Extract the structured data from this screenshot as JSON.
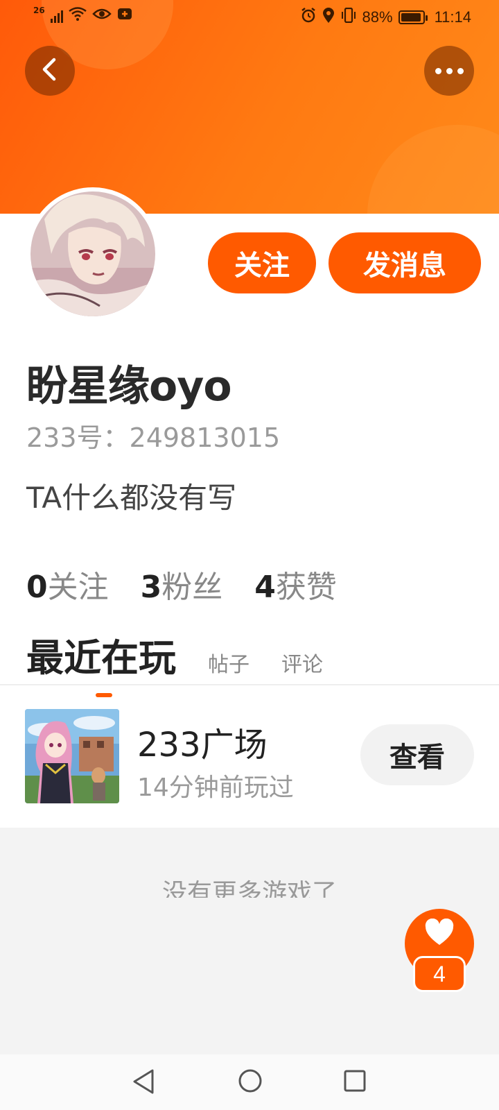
{
  "status_bar": {
    "network": "26",
    "battery_percent": "88%",
    "time": "11:14"
  },
  "header": {
    "back_icon": "chevron-left-icon",
    "more_icon": "more-dots-icon",
    "accent_color": "#ff5a00"
  },
  "profile": {
    "follow_label": "关注",
    "message_label": "发消息",
    "username": "盼星缘oyo",
    "uid_label": "233号：249813015",
    "bio": "TA什么都没有写"
  },
  "stats": [
    {
      "num": "0",
      "label": "关注"
    },
    {
      "num": "3",
      "label": "粉丝"
    },
    {
      "num": "4",
      "label": "获赞"
    }
  ],
  "tabs": {
    "active": "最近在玩",
    "posts": "帖子",
    "comments": "评论"
  },
  "game": {
    "name": "233广场",
    "last_played": "14分钟前玩过",
    "view_label": "查看"
  },
  "footer": {
    "no_more": "没有更多游戏了"
  },
  "like": {
    "icon": "heart-icon",
    "count": "4"
  }
}
